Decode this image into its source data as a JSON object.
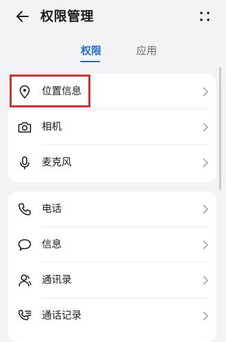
{
  "header": {
    "title": "权限管理",
    "back_icon": "back-arrow-icon",
    "more_icon": "more-dots-icon"
  },
  "tabs": [
    {
      "label": "权限",
      "selected": true
    },
    {
      "label": "应用",
      "selected": false
    }
  ],
  "colors": {
    "accent": "#1a6ad8",
    "highlight_border": "#e12b2b",
    "background": "#f1f3f5"
  },
  "groups": [
    {
      "items": [
        {
          "label": "位置信息",
          "icon": "location-pin-icon",
          "highlighted": true
        },
        {
          "label": "相机",
          "icon": "camera-icon"
        },
        {
          "label": "麦克风",
          "icon": "microphone-icon"
        }
      ]
    },
    {
      "items": [
        {
          "label": "电话",
          "icon": "phone-icon"
        },
        {
          "label": "信息",
          "icon": "message-bubble-icon"
        },
        {
          "label": "通讯录",
          "icon": "contacts-icon"
        },
        {
          "label": "通话记录",
          "icon": "call-log-icon"
        }
      ]
    }
  ]
}
